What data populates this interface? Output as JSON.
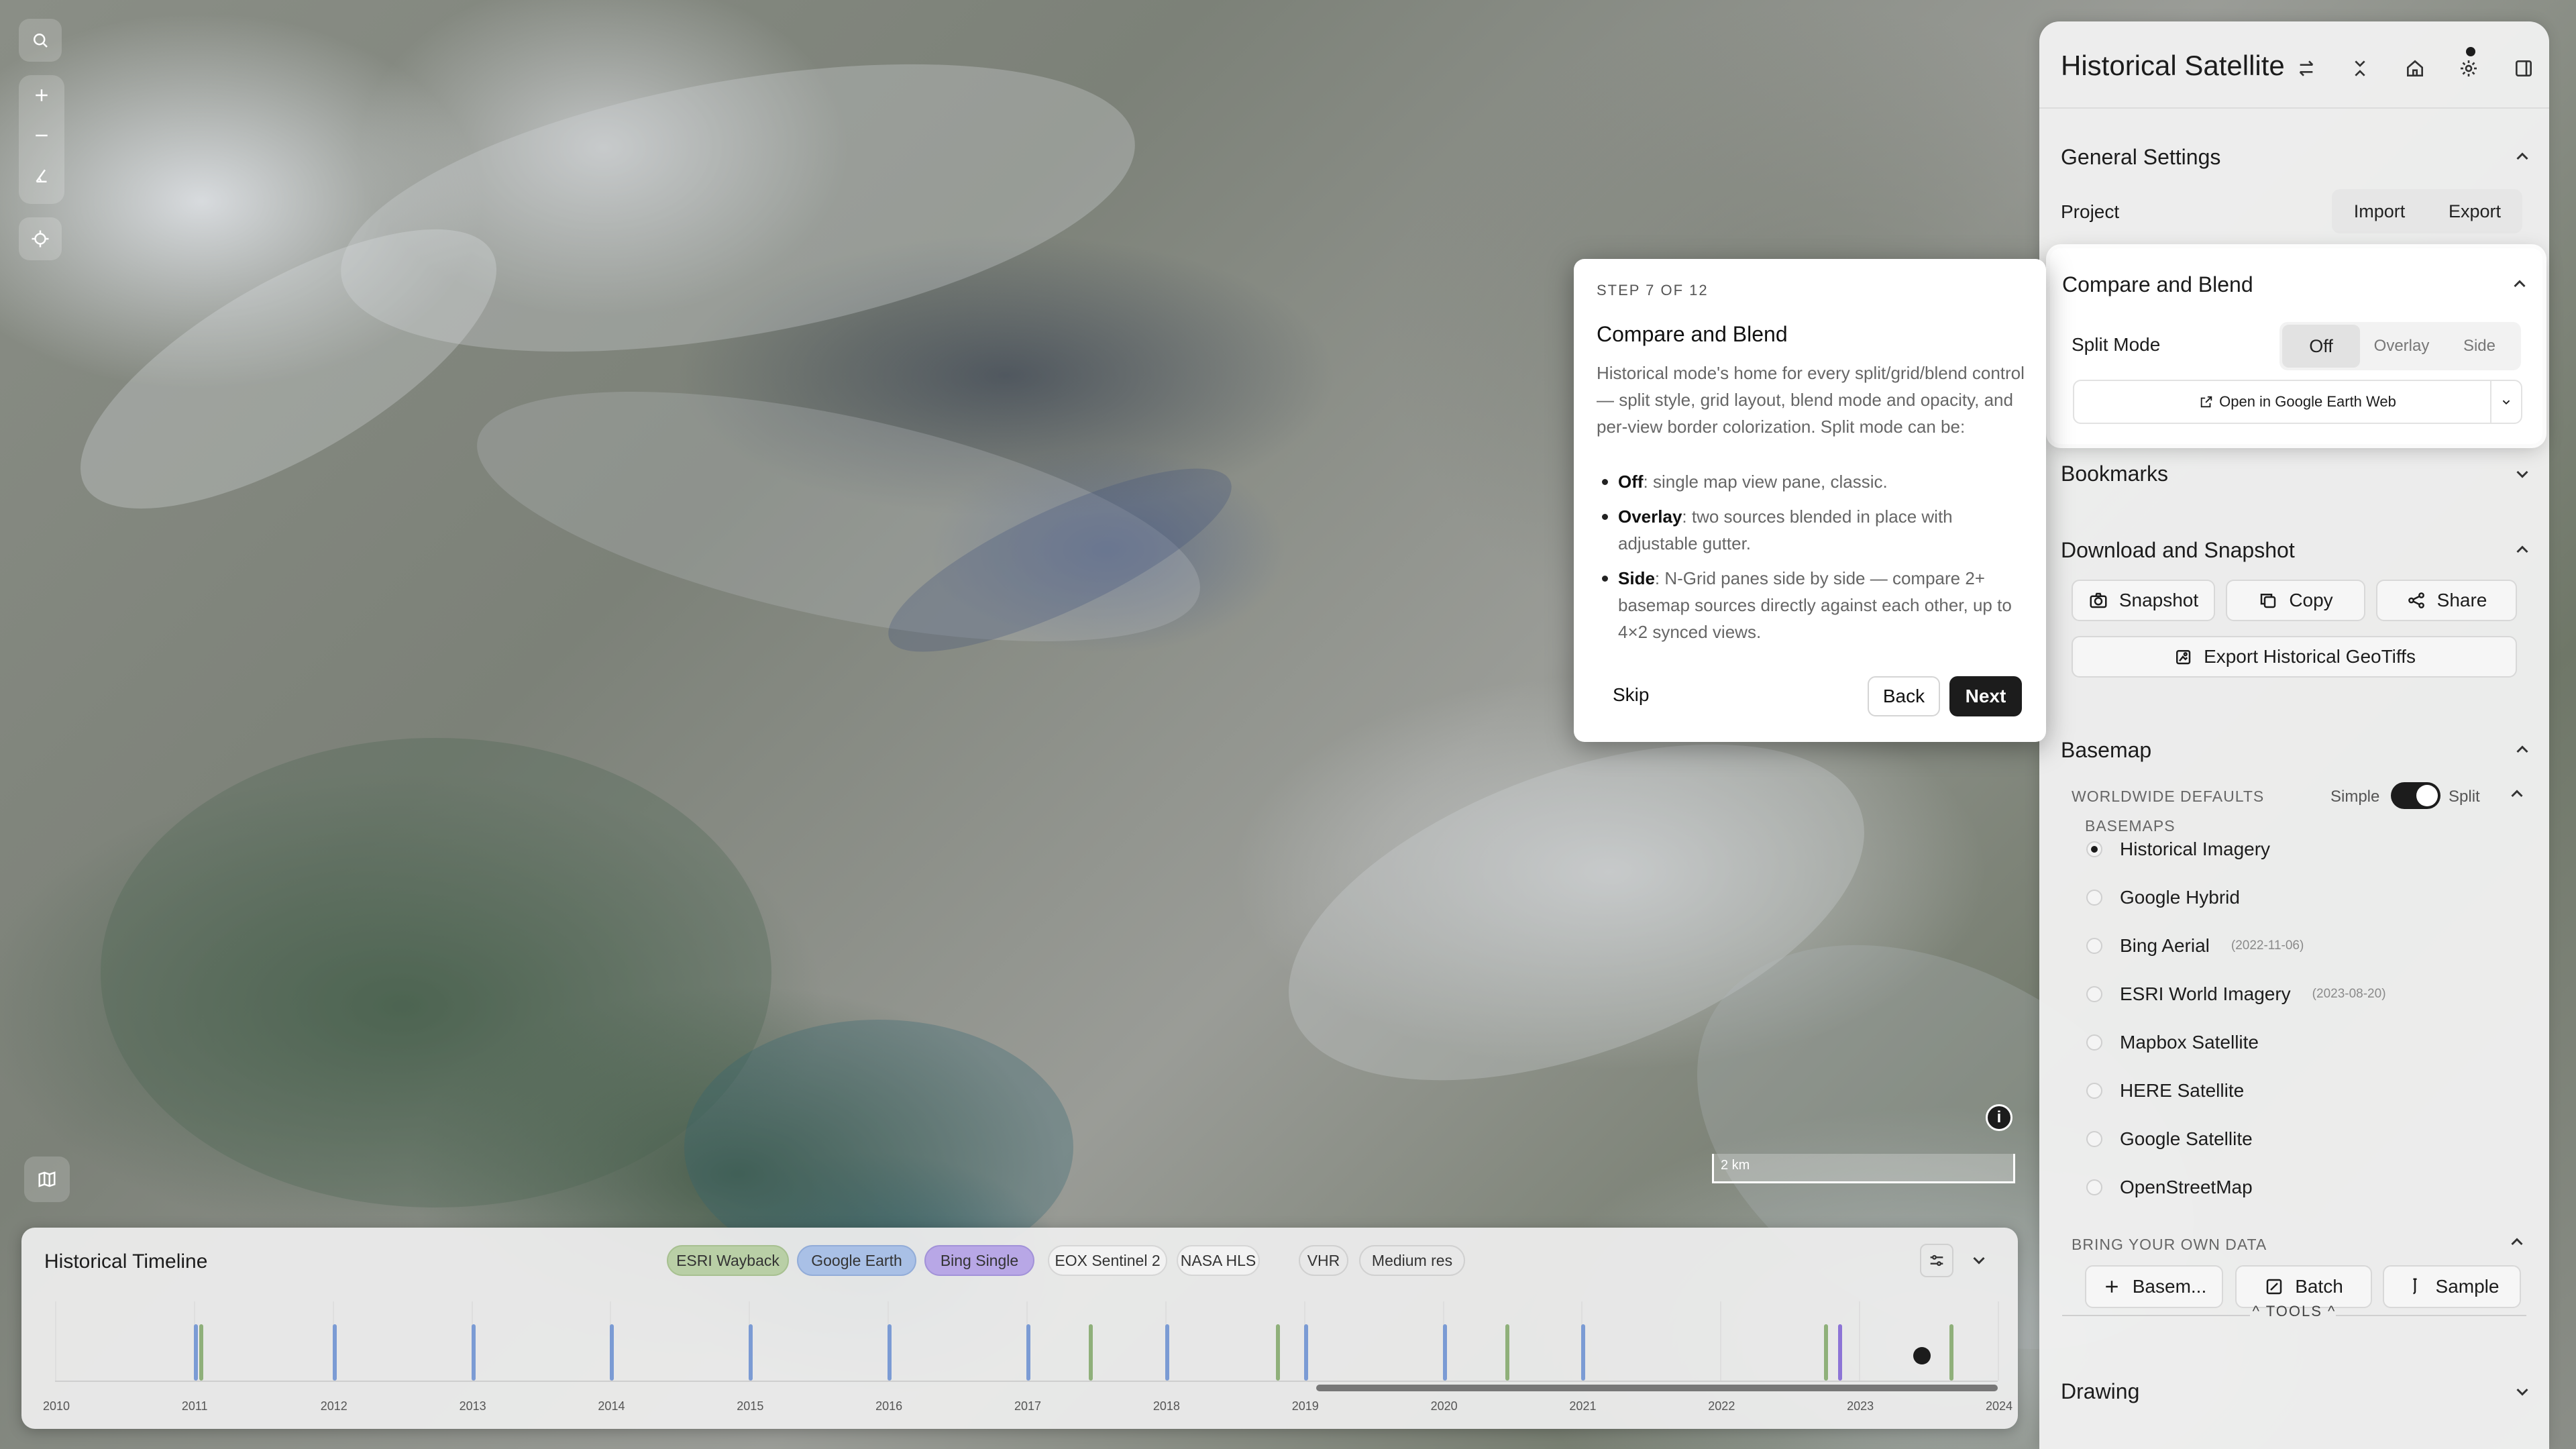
{
  "panel": {
    "title": "Historical Satellite",
    "general_settings": {
      "title": "General Settings",
      "project_label": "Project",
      "import_label": "Import",
      "export_label": "Export"
    },
    "compare_and_blend": {
      "title": "Compare and Blend",
      "split_mode_label": "Split Mode",
      "split_options": [
        "Off",
        "Overlay",
        "Side"
      ],
      "selected": "Off",
      "open_in_label": "Open in Google Earth Web"
    },
    "bookmarks": {
      "title": "Bookmarks"
    },
    "download": {
      "title": "Download and Snapshot",
      "snapshot_label": "Snapshot",
      "copy_label": "Copy",
      "share_label": "Share",
      "export_label": "Export Historical GeoTiffs"
    },
    "basemap": {
      "title": "Basemap",
      "worldwide_defaults": "WORLDWIDE DEFAULTS",
      "simple_label": "Simple",
      "split_label": "Split",
      "basemaps_label": "BASEMAPS",
      "items": [
        {
          "label": "Historical Imagery",
          "date": "",
          "selected": true
        },
        {
          "label": "Google Hybrid",
          "date": "",
          "selected": false
        },
        {
          "label": "Bing Aerial",
          "date": "(2022-11-06)",
          "selected": false
        },
        {
          "label": "ESRI World Imagery",
          "date": "(2023-08-20)",
          "selected": false
        },
        {
          "label": "Mapbox Satellite",
          "date": "",
          "selected": false
        },
        {
          "label": "HERE Satellite",
          "date": "",
          "selected": false
        },
        {
          "label": "Google Satellite",
          "date": "",
          "selected": false
        },
        {
          "label": "OpenStreetMap",
          "date": "",
          "selected": false
        }
      ],
      "bring_your_own": "BRING YOUR OWN DATA",
      "basemap_btn": "Basem...",
      "batch_btn": "Batch",
      "sample_btn": "Sample",
      "tools_label": "TOOLS"
    },
    "drawing": {
      "title": "Drawing"
    }
  },
  "tour": {
    "step": "STEP 7 OF 12",
    "title": "Compare and Blend",
    "body": "Historical mode's home for every split/grid/blend control — split style, grid layout, blend mode and opacity, and per-view border colorization. Split mode can be:",
    "items": [
      {
        "term": "Off",
        "text": ": single map view pane, classic."
      },
      {
        "term": "Overlay",
        "text": ": two sources blended in place with adjustable gutter."
      },
      {
        "term": "Side",
        "text": ": N-Grid panes side by side — compare 2+ basemap sources directly against each other, up to 4×2 synced views."
      }
    ],
    "skip": "Skip",
    "back": "Back",
    "next": "Next"
  },
  "timeline": {
    "title": "Historical Timeline",
    "chips": [
      {
        "label": "ESRI Wayback",
        "bg": "#b9cfa6",
        "border": "#a7c090"
      },
      {
        "label": "Google Earth",
        "bg": "#a9c0e6",
        "border": "#92acd8"
      },
      {
        "label": "Bing Single",
        "bg": "#b8a7e6",
        "border": "#a292d8"
      },
      {
        "label": "EOX Sentinel 2",
        "bg": "#f2f2f2",
        "border": "#d6d6d6"
      },
      {
        "label": "NASA HLS",
        "bg": "#f2f2f2",
        "border": "#d6d6d6"
      },
      {
        "label": "VHR",
        "bg": "#e8e8e8",
        "border": "#d0d0d0"
      },
      {
        "label": "Medium res",
        "bg": "#e8e8e8",
        "border": "#d0d0d0"
      }
    ],
    "years": [
      "2010",
      "2011",
      "2012",
      "2013",
      "2014",
      "2015",
      "2016",
      "2017",
      "2018",
      "2019",
      "2020",
      "2021",
      "2022",
      "2023",
      "2024"
    ]
  },
  "map": {
    "scale_label": "2 km"
  },
  "colors": {
    "esri": "#8fb07a",
    "google": "#7b9bd4",
    "bing": "#8d74d6",
    "dark": "#1c1c1c"
  }
}
